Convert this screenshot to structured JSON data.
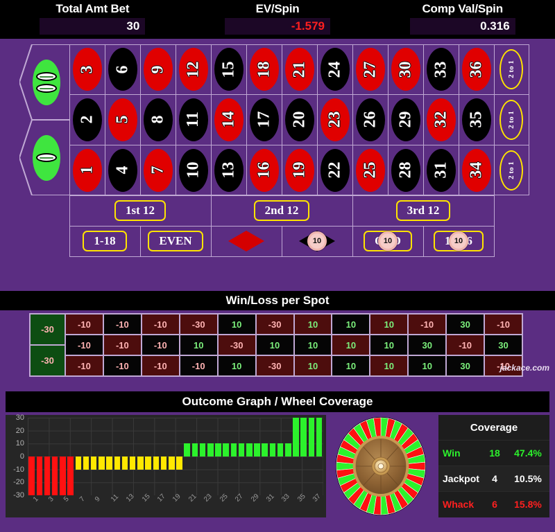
{
  "header": {
    "cells": [
      {
        "label": "Total Amt Bet",
        "value": "30",
        "negative": false
      },
      {
        "label": "EV/Spin",
        "value": "-1.579",
        "negative": true
      },
      {
        "label": "Comp Val/Spin",
        "value": "0.316",
        "negative": false
      }
    ]
  },
  "table": {
    "zeros": [
      {
        "name": "double-zero",
        "label": "00",
        "pills": 2
      },
      {
        "name": "zero",
        "label": "0",
        "pills": 1
      }
    ],
    "numbers": [
      {
        "n": "3",
        "color": "red"
      },
      {
        "n": "6",
        "color": "black"
      },
      {
        "n": "9",
        "color": "red"
      },
      {
        "n": "12",
        "color": "red"
      },
      {
        "n": "15",
        "color": "black"
      },
      {
        "n": "18",
        "color": "red"
      },
      {
        "n": "21",
        "color": "red"
      },
      {
        "n": "24",
        "color": "black"
      },
      {
        "n": "27",
        "color": "red"
      },
      {
        "n": "30",
        "color": "red"
      },
      {
        "n": "33",
        "color": "black"
      },
      {
        "n": "36",
        "color": "red"
      },
      {
        "n": "2",
        "color": "black"
      },
      {
        "n": "5",
        "color": "red"
      },
      {
        "n": "8",
        "color": "black"
      },
      {
        "n": "11",
        "color": "black"
      },
      {
        "n": "14",
        "color": "red"
      },
      {
        "n": "17",
        "color": "black"
      },
      {
        "n": "20",
        "color": "black"
      },
      {
        "n": "23",
        "color": "red"
      },
      {
        "n": "26",
        "color": "black"
      },
      {
        "n": "29",
        "color": "black"
      },
      {
        "n": "32",
        "color": "red"
      },
      {
        "n": "35",
        "color": "black"
      },
      {
        "n": "1",
        "color": "red"
      },
      {
        "n": "4",
        "color": "black"
      },
      {
        "n": "7",
        "color": "red"
      },
      {
        "n": "10",
        "color": "black"
      },
      {
        "n": "13",
        "color": "black"
      },
      {
        "n": "16",
        "color": "red"
      },
      {
        "n": "19",
        "color": "red"
      },
      {
        "n": "22",
        "color": "black"
      },
      {
        "n": "25",
        "color": "red"
      },
      {
        "n": "28",
        "color": "black"
      },
      {
        "n": "31",
        "color": "black"
      },
      {
        "n": "34",
        "color": "red"
      }
    ],
    "column_bets": [
      "2 to 1",
      "2 to 1",
      "2 to 1"
    ],
    "dozens": [
      "1st 12",
      "2nd 12",
      "3rd 12"
    ],
    "outside": [
      {
        "label": "1-18",
        "kind": "pill",
        "chip": null
      },
      {
        "label": "EVEN",
        "kind": "pill",
        "chip": null
      },
      {
        "label": "",
        "kind": "diamond-red",
        "chip": null
      },
      {
        "label": "",
        "kind": "diamond-black",
        "chip": "10"
      },
      {
        "label": "ODD",
        "kind": "pill",
        "chip": "10"
      },
      {
        "label": "19-36",
        "kind": "pill",
        "chip": "10"
      }
    ]
  },
  "winloss": {
    "title": "Win/Loss per Spot",
    "watermark": "jackace.com",
    "zero_cells": [
      {
        "label": "00",
        "value": "-30"
      },
      {
        "label": "0",
        "value": "-30"
      }
    ],
    "cells": [
      {
        "n": "3",
        "color": "red",
        "value": "-10"
      },
      {
        "n": "6",
        "color": "black",
        "value": "-10"
      },
      {
        "n": "9",
        "color": "red",
        "value": "-10"
      },
      {
        "n": "12",
        "color": "red",
        "value": "-30"
      },
      {
        "n": "15",
        "color": "black",
        "value": "10"
      },
      {
        "n": "18",
        "color": "red",
        "value": "-30"
      },
      {
        "n": "21",
        "color": "red",
        "value": "10"
      },
      {
        "n": "24",
        "color": "black",
        "value": "10"
      },
      {
        "n": "27",
        "color": "red",
        "value": "10"
      },
      {
        "n": "30",
        "color": "red",
        "value": "-10"
      },
      {
        "n": "33",
        "color": "black",
        "value": "30"
      },
      {
        "n": "36",
        "color": "red",
        "value": "-10"
      },
      {
        "n": "2",
        "color": "black",
        "value": "-10"
      },
      {
        "n": "5",
        "color": "red",
        "value": "-10"
      },
      {
        "n": "8",
        "color": "black",
        "value": "-10"
      },
      {
        "n": "11",
        "color": "black",
        "value": "10"
      },
      {
        "n": "14",
        "color": "red",
        "value": "-30"
      },
      {
        "n": "17",
        "color": "black",
        "value": "10"
      },
      {
        "n": "20",
        "color": "black",
        "value": "10"
      },
      {
        "n": "23",
        "color": "red",
        "value": "10"
      },
      {
        "n": "26",
        "color": "black",
        "value": "10"
      },
      {
        "n": "29",
        "color": "black",
        "value": "30"
      },
      {
        "n": "32",
        "color": "red",
        "value": "-10"
      },
      {
        "n": "35",
        "color": "black",
        "value": "30"
      },
      {
        "n": "1",
        "color": "red",
        "value": "-10"
      },
      {
        "n": "4",
        "color": "black",
        "value": "-10"
      },
      {
        "n": "7",
        "color": "red",
        "value": "-10"
      },
      {
        "n": "10",
        "color": "black",
        "value": "-10"
      },
      {
        "n": "13",
        "color": "black",
        "value": "10"
      },
      {
        "n": "16",
        "color": "red",
        "value": "-30"
      },
      {
        "n": "19",
        "color": "red",
        "value": "10"
      },
      {
        "n": "22",
        "color": "black",
        "value": "10"
      },
      {
        "n": "25",
        "color": "red",
        "value": "10"
      },
      {
        "n": "28",
        "color": "black",
        "value": "10"
      },
      {
        "n": "31",
        "color": "black",
        "value": "30"
      },
      {
        "n": "34",
        "color": "red",
        "value": "-10"
      }
    ]
  },
  "outcome": {
    "title": "Outcome Graph / Wheel Coverage",
    "coverage": {
      "title": "Coverage",
      "rows": [
        {
          "name": "Win",
          "count": "18",
          "pct": "47.4%",
          "color": "#2cf22c"
        },
        {
          "name": "Jackpot",
          "count": "4",
          "pct": "10.5%",
          "color": "#ffffff"
        },
        {
          "name": "Whack",
          "count": "6",
          "pct": "15.8%",
          "color": "#ff2020"
        }
      ]
    }
  },
  "chart_data": {
    "type": "bar",
    "title": "Outcome Graph / Wheel Coverage",
    "xlabel": "",
    "ylabel": "",
    "ylim": [
      -30,
      30
    ],
    "yticks": [
      30,
      20,
      10,
      0,
      -10,
      -20,
      -30
    ],
    "grid": true,
    "legend": null,
    "categories": [
      "1",
      "2",
      "3",
      "4",
      "5",
      "6",
      "7",
      "8",
      "9",
      "10",
      "11",
      "12",
      "13",
      "14",
      "15",
      "16",
      "17",
      "18",
      "19",
      "20",
      "21",
      "22",
      "23",
      "24",
      "25",
      "26",
      "27",
      "28",
      "29",
      "30",
      "31",
      "32",
      "33",
      "34",
      "35",
      "36",
      "37",
      "38"
    ],
    "xtick_labels": [
      "1",
      "3",
      "5",
      "7",
      "9",
      "11",
      "13",
      "15",
      "17",
      "19",
      "21",
      "23",
      "25",
      "27",
      "29",
      "31",
      "33",
      "35",
      "37"
    ],
    "values": [
      -30,
      -30,
      -30,
      -30,
      -30,
      -30,
      -10,
      -10,
      -10,
      -10,
      -10,
      -10,
      -10,
      -10,
      -10,
      -10,
      -10,
      -10,
      -10,
      -10,
      10,
      10,
      10,
      10,
      10,
      10,
      10,
      10,
      10,
      10,
      10,
      10,
      10,
      10,
      30,
      30,
      30,
      30
    ],
    "bar_colors": [
      "red",
      "red",
      "red",
      "red",
      "red",
      "red",
      "yellow",
      "yellow",
      "yellow",
      "yellow",
      "yellow",
      "yellow",
      "yellow",
      "yellow",
      "yellow",
      "yellow",
      "yellow",
      "yellow",
      "yellow",
      "yellow",
      "green",
      "green",
      "green",
      "green",
      "green",
      "green",
      "green",
      "green",
      "green",
      "green",
      "green",
      "green",
      "green",
      "green",
      "green",
      "green",
      "green",
      "green"
    ],
    "color_map": {
      "red": "#ff1111",
      "yellow": "#ffe800",
      "green": "#2cf22c"
    }
  },
  "wheel": {
    "segments": 38,
    "win_color": "#2cf22c",
    "whack_color": "#ff1111",
    "hub_color": "#9a6f3c"
  }
}
